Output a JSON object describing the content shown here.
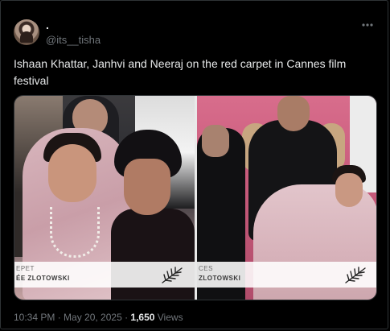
{
  "tweet": {
    "display_name": ".",
    "handle": "@its__tisha",
    "more_icon": "ellipsis-icon",
    "text": "Ishaan Khattar, Janhvi and Neeraj on the red carpet in Cannes film festival",
    "timestamp": "10:34 PM · May 20, 2025 · ",
    "views_count": "1,650",
    "views_label": " Views"
  },
  "media": {
    "left_panel": {
      "caption_line1": "EPET",
      "caption_line2": "ÉE    ZLOTOWSKI"
    },
    "right_panel": {
      "caption_line1": "CES",
      "caption_line2": "ZLOTOWSKI"
    },
    "logo_icon": "palm-leaf-icon"
  },
  "colors": {
    "background": "#000000",
    "primary_text": "#e7e9ea",
    "secondary_text": "#71767b",
    "border": "#2f3336"
  }
}
